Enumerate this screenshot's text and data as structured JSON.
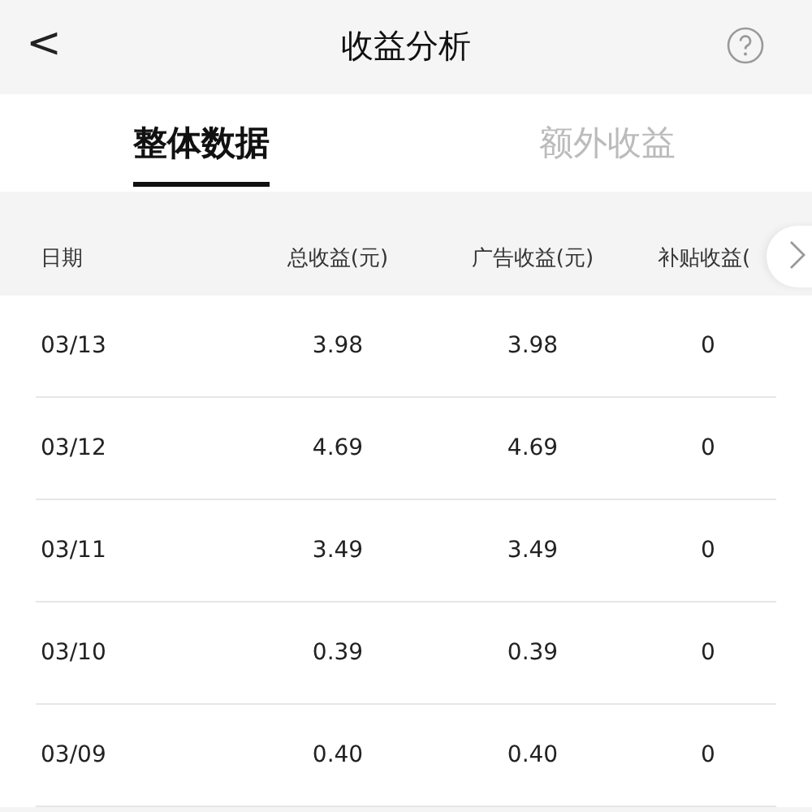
{
  "header": {
    "back_icon": "<",
    "title": "收益分析"
  },
  "tabs": [
    {
      "label": "整体数据",
      "selected": true
    },
    {
      "label": "额外收益",
      "selected": false
    }
  ],
  "table": {
    "columns": [
      "日期",
      "总收益(元)",
      "广告收益(元)",
      "补贴收益("
    ],
    "rows": [
      [
        "03/13",
        "3.98",
        "3.98",
        "0"
      ],
      [
        "03/12",
        "4.69",
        "4.69",
        "0"
      ],
      [
        "03/11",
        "3.49",
        "3.49",
        "0"
      ],
      [
        "03/10",
        "0.39",
        "0.39",
        "0"
      ],
      [
        "03/09",
        "0.40",
        "0.40",
        "0"
      ]
    ]
  }
}
